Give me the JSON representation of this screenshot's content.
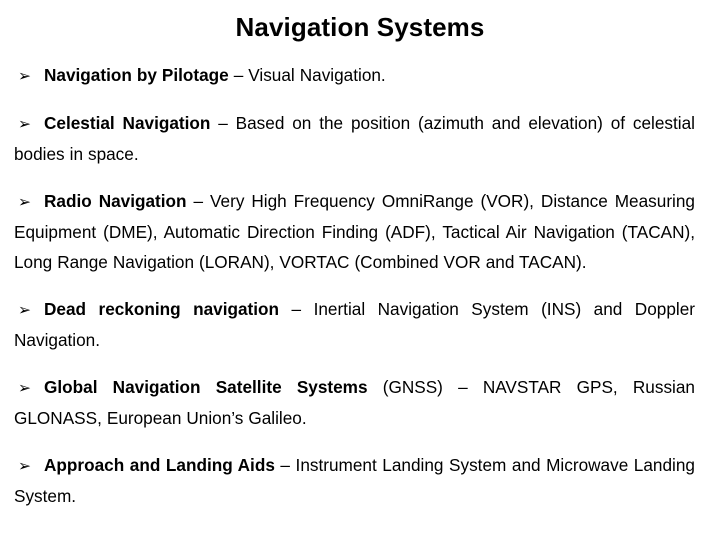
{
  "slide": {
    "title": "Navigation Systems",
    "bullet_glyph": "➢",
    "bullet_glyph_name": "arrowhead-bullet-icon",
    "text_color": "#000000",
    "background_color": "#ffffff",
    "bullets": [
      {
        "lead": "Navigation by Pilotage",
        "rest": " – Visual Navigation."
      },
      {
        "lead": "Celestial Navigation",
        "rest": " – Based on the position (azimuth and elevation) of celestial bodies in space."
      },
      {
        "lead": "Radio Navigation",
        "rest": " – Very High Frequency OmniRange (VOR), Distance Measuring Equipment (DME), Automatic Direction Finding (ADF), Tactical Air Navigation (TACAN), Long Range Navigation (LORAN), VORTAC (Combined VOR and TACAN)."
      },
      {
        "lead": "Dead reckoning navigation",
        "rest": " – Inertial Navigation System (INS) and Doppler Navigation."
      },
      {
        "lead": "Global Navigation Satellite Systems",
        "rest": " (GNSS) – NAVSTAR GPS, Russian GLONASS, European Union’s Galileo."
      },
      {
        "lead": "Approach and Landing Aids",
        "rest": " – Instrument Landing System and Microwave Landing System."
      }
    ]
  }
}
